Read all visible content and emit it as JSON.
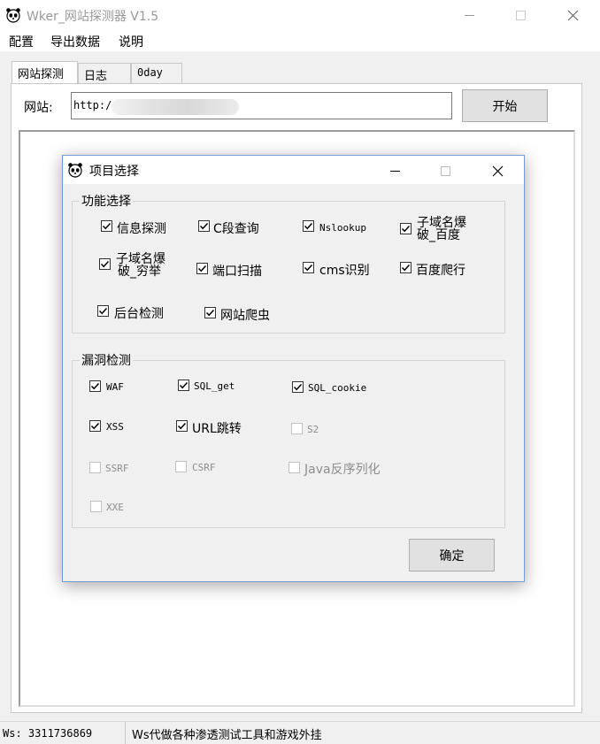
{
  "window": {
    "title": "Wker_网站探测器 V1.5"
  },
  "menu": [
    "配置",
    "导出数据",
    "说明"
  ],
  "tabs": [
    "网站探测",
    "日志",
    "0day"
  ],
  "probe": {
    "url_label": "网站:",
    "url_value": "http:/",
    "start_button": "开始"
  },
  "dialog": {
    "title": "项目选择",
    "function_group": {
      "legend": "功能选择",
      "items": [
        {
          "label": "信息探测",
          "checked": true
        },
        {
          "label": "C段查询",
          "checked": true
        },
        {
          "label": "Nslookup",
          "checked": true
        },
        {
          "label": "子域名爆破_百度",
          "line1": "子域名爆",
          "line2": "破_百度",
          "checked": true
        },
        {
          "label": "子域名爆破_穷举",
          "line1": "子域名爆",
          "line2": "破_穷举",
          "checked": true
        },
        {
          "label": "端口扫描",
          "checked": true
        },
        {
          "label": "cms识别",
          "checked": true
        },
        {
          "label": "百度爬行",
          "checked": true
        },
        {
          "label": "后台检测",
          "checked": true
        },
        {
          "label": "网站爬虫",
          "checked": true
        }
      ]
    },
    "vuln_group": {
      "legend": "漏洞检测",
      "items": [
        {
          "label": "WAF",
          "checked": true,
          "enabled": true
        },
        {
          "label": "SQL_get",
          "checked": true,
          "enabled": true
        },
        {
          "label": "SQL_cookie",
          "checked": true,
          "enabled": true
        },
        {
          "label": "XSS",
          "checked": true,
          "enabled": true
        },
        {
          "label": "URL跳转",
          "checked": true,
          "enabled": true
        },
        {
          "label": "S2",
          "checked": false,
          "enabled": false
        },
        {
          "label": "SSRF",
          "checked": false,
          "enabled": false
        },
        {
          "label": "CSRF",
          "checked": false,
          "enabled": false
        },
        {
          "label": "Java反序列化",
          "checked": false,
          "enabled": false
        },
        {
          "label": "XXE",
          "checked": false,
          "enabled": false
        }
      ]
    },
    "ok_button": "确定"
  },
  "status": {
    "left": "Ws: 3311736869",
    "right": "Ws代做各种渗透测试工具和游戏外挂"
  }
}
